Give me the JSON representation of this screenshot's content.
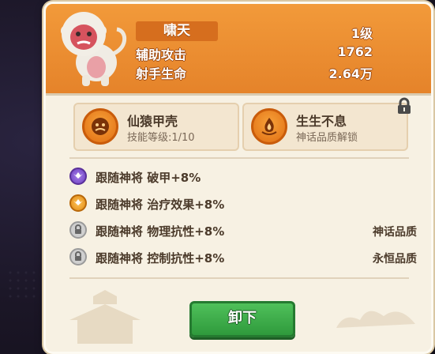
{
  "header": {
    "name": "啸天",
    "level": "1级",
    "stat1_label": "辅助攻击",
    "stat1_value": "1762",
    "stat2_label": "射手生命",
    "stat2_value": "2.64万",
    "portrait_icon": "white-monkey-portrait"
  },
  "cards": [
    {
      "title": "仙猿甲壳",
      "subtitle": "技能等级:1/10",
      "icon": "ape-skill-icon",
      "locked": false
    },
    {
      "title": "生生不息",
      "subtitle": "神话品质解锁",
      "icon": "flame-skill-icon",
      "locked": true
    }
  ],
  "bonuses": [
    {
      "text": "跟随神将 破甲+8%",
      "icon": "purple-wings-icon",
      "right": ""
    },
    {
      "text": "跟随神将 治疗效果+8%",
      "icon": "orange-wings-icon",
      "right": ""
    },
    {
      "text": "跟随神将 物理抗性+8%",
      "icon": "lock-icon",
      "right": "神话品质"
    },
    {
      "text": "跟随神将 控制抗性+8%",
      "icon": "lock-icon",
      "right": "永恒品质"
    }
  ],
  "button": {
    "label": "卸下"
  },
  "colors": {
    "header": "#f29a3a",
    "panel": "#f7f1e3",
    "button": "#3aa847",
    "purple": "#8a5bd6",
    "orange": "#f0a232"
  }
}
